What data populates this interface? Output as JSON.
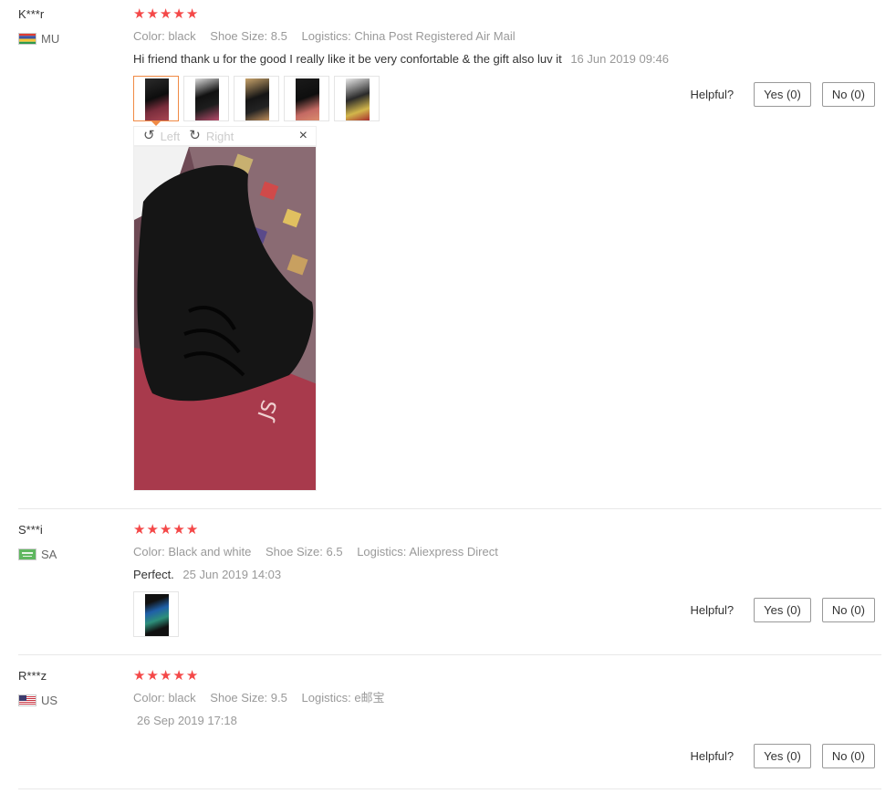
{
  "reviews": [
    {
      "user": "K***r",
      "country": "MU",
      "flag": "mauritius-flag-icon",
      "rating": 5,
      "stars": [
        "★",
        "★",
        "★",
        "★",
        "★"
      ],
      "meta": [
        {
          "key": "Color:",
          "value": "black"
        },
        {
          "key": "Shoe Size:",
          "value": "8.5"
        },
        {
          "key": "Logistics:",
          "value": "China Post Registered Air Mail"
        }
      ],
      "text": "Hi friend thank u for the good I really like it be very confortable & the gift also luv it",
      "date": "16 Jun 2019 09:46",
      "photo_count": 5,
      "helpful_label": "Helpful?",
      "yes_label": "Yes (0)",
      "no_label": "No (0)"
    },
    {
      "user": "S***i",
      "country": "SA",
      "flag": "saudi-flag-icon",
      "rating": 5,
      "stars": [
        "★",
        "★",
        "★",
        "★",
        "★"
      ],
      "meta": [
        {
          "key": "Color:",
          "value": "Black and white"
        },
        {
          "key": "Shoe Size:",
          "value": "6.5"
        },
        {
          "key": "Logistics:",
          "value": "Aliexpress Direct"
        }
      ],
      "text": "Perfect.",
      "date": "25 Jun 2019 14:03",
      "photo_count": 1,
      "helpful_label": "Helpful?",
      "yes_label": "Yes (0)",
      "no_label": "No (0)"
    },
    {
      "user": "R***z",
      "country": "US",
      "flag": "us-flag-icon",
      "rating": 5,
      "stars": [
        "★",
        "★",
        "★",
        "★",
        "★"
      ],
      "meta": [
        {
          "key": "Color:",
          "value": "black"
        },
        {
          "key": "Shoe Size:",
          "value": "9.5"
        },
        {
          "key": "Logistics:",
          "value": "e邮宝"
        }
      ],
      "text": "",
      "date": "26 Sep 2019 17:18",
      "photo_count": 0,
      "helpful_label": "Helpful?",
      "yes_label": "Yes (0)",
      "no_label": "No (0)"
    }
  ],
  "viewer": {
    "rotate_left_label": "Left",
    "rotate_right_label": "Right",
    "close_symbol": "×",
    "rotate_left_icon": "↺",
    "rotate_right_icon": "↻"
  },
  "colors": {
    "star": "#f44848",
    "active_thumb": "#f08a45",
    "muted_text": "#999999"
  }
}
